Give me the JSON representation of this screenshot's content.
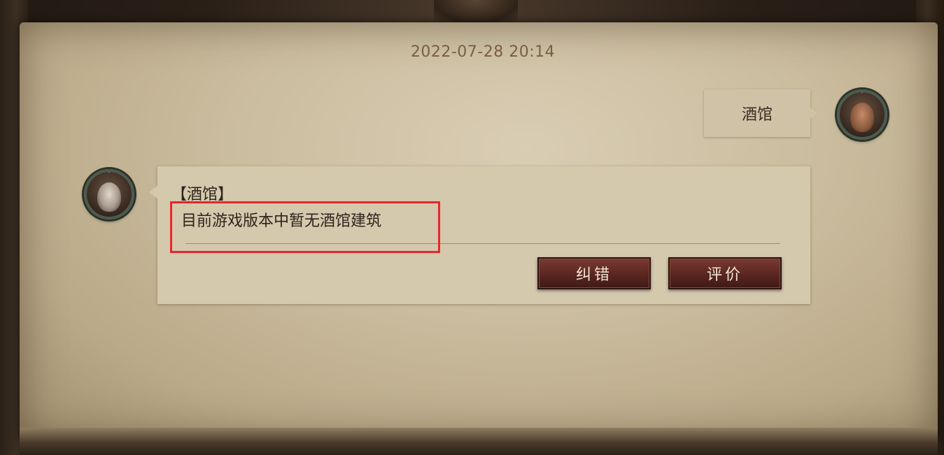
{
  "chat": {
    "timestamp": "2022-07-28 20:14",
    "user_message": "酒馆",
    "bot_reply": {
      "title": "【酒馆】",
      "answer": "目前游戏版本中暂无酒馆建筑"
    },
    "actions": {
      "correct_label": "纠错",
      "rate_label": "评价"
    }
  },
  "colors": {
    "highlight_border": "#e8262a",
    "button_bg": "#5a2620",
    "parchment": "#cbbd9f",
    "timestamp_text": "#7b5e43"
  },
  "icons": {
    "user_avatar": "user-avatar-icon",
    "bot_avatar": "assistant-avatar-icon"
  }
}
